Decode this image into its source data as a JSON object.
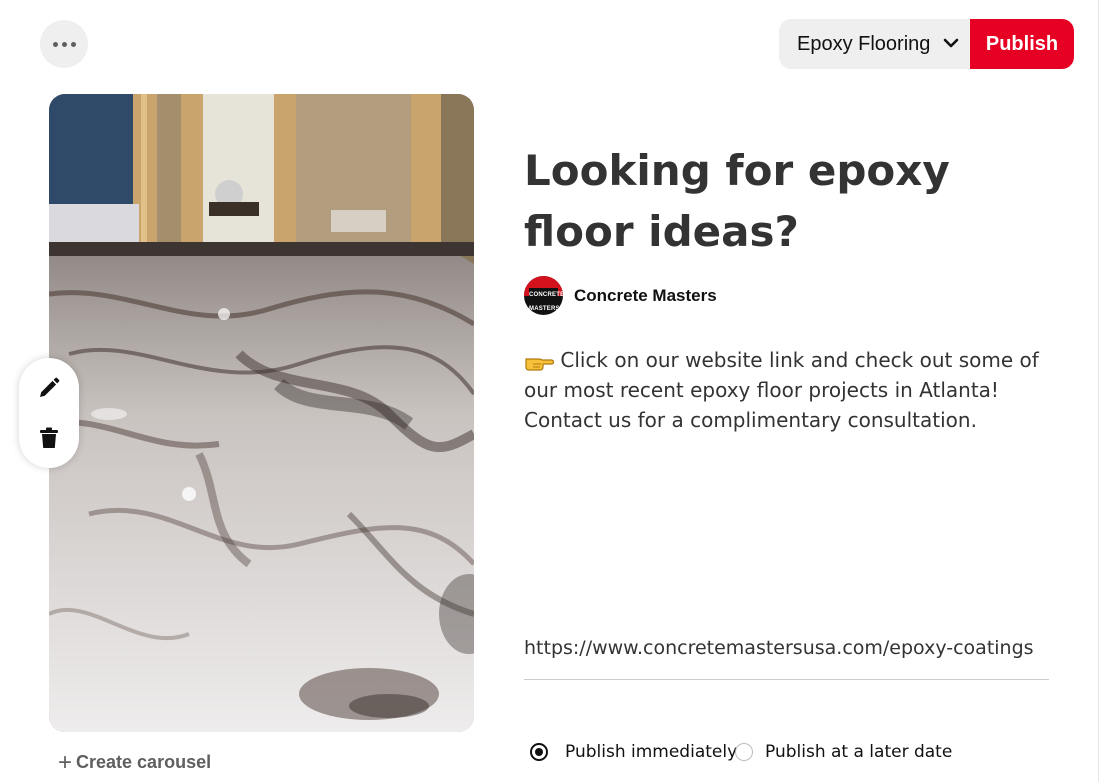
{
  "header": {
    "more_icon": "ellipsis-icon",
    "board_selected": "Epoxy Flooring",
    "publish_label": "Publish",
    "publish_color": "#e60023"
  },
  "pin": {
    "title": "Looking for epoxy floor ideas?",
    "author": "Concrete Masters",
    "avatar_text": "CONCRETE MASTERS",
    "description": "Click on our website link and check out some of our most recent epoxy floor projects in Atlanta! Contact us for a complimentary consultation.",
    "description_icon": "pointing-hand-emoji",
    "link": "https://www.concretemastersusa.com/epoxy-coatings"
  },
  "tools": {
    "edit_icon": "pencil-icon",
    "delete_icon": "trash-icon"
  },
  "carousel": {
    "label": "Create carousel"
  },
  "publish_options": {
    "immediately": "Publish immediately",
    "later": "Publish at a later date",
    "selected": "immediately"
  }
}
